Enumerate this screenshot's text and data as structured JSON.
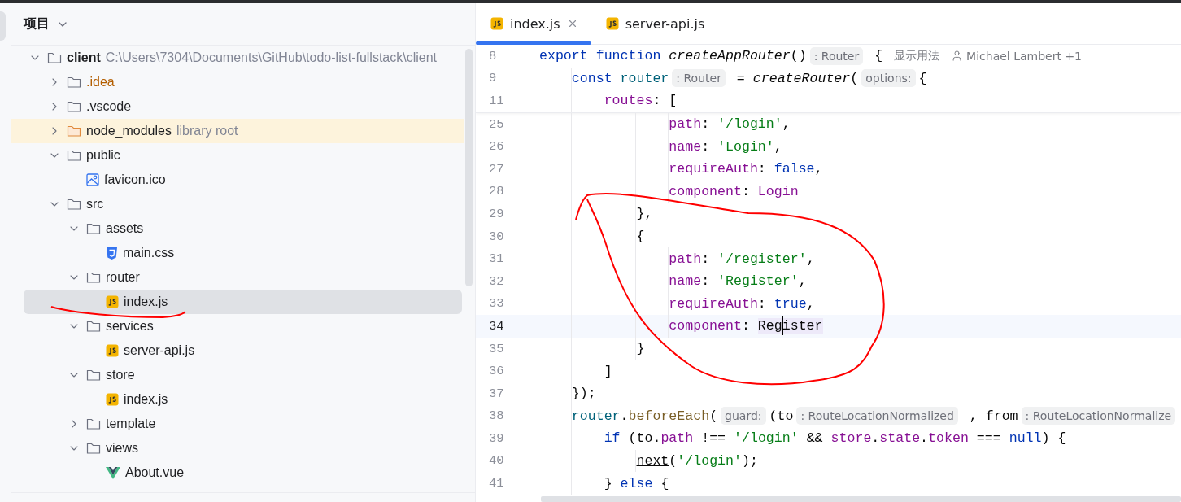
{
  "project_panel": {
    "title": "项目",
    "tree": [
      {
        "name": "client",
        "kind": "folder",
        "path": "C:\\Users\\7304\\Documents\\GitHub\\todo-list-fullstack\\client",
        "expanded": true,
        "selected": false,
        "children": [
          {
            "name": ".idea",
            "kind": "folder",
            "excluded": true,
            "expanded": false,
            "selected": false
          },
          {
            "name": ".vscode",
            "kind": "folder",
            "expanded": false,
            "selected": false
          },
          {
            "name": "node_modules",
            "kind": "library",
            "note": "library root",
            "expanded": false,
            "selected": false
          },
          {
            "name": "public",
            "kind": "folder",
            "expanded": true,
            "selected": false,
            "children": [
              {
                "name": "favicon.ico",
                "kind": "image",
                "selected": false
              }
            ]
          },
          {
            "name": "src",
            "kind": "folder",
            "expanded": true,
            "selected": false,
            "children": [
              {
                "name": "assets",
                "kind": "folder",
                "expanded": true,
                "selected": false,
                "children": [
                  {
                    "name": "main.css",
                    "kind": "css",
                    "selected": false
                  }
                ]
              },
              {
                "name": "router",
                "kind": "folder",
                "expanded": true,
                "selected": false,
                "children": [
                  {
                    "name": "index.js",
                    "kind": "js",
                    "selected": true
                  }
                ]
              },
              {
                "name": "services",
                "kind": "folder",
                "expanded": true,
                "selected": false,
                "children": [
                  {
                    "name": "server-api.js",
                    "kind": "js",
                    "selected": false
                  }
                ]
              },
              {
                "name": "store",
                "kind": "folder",
                "expanded": true,
                "selected": false,
                "children": [
                  {
                    "name": "index.js",
                    "kind": "js",
                    "selected": false
                  }
                ]
              },
              {
                "name": "template",
                "kind": "folder",
                "expanded": false,
                "selected": false
              },
              {
                "name": "views",
                "kind": "folder",
                "expanded": true,
                "selected": false,
                "children": [
                  {
                    "name": "About.vue",
                    "kind": "vue",
                    "selected": false
                  }
                ]
              }
            ]
          }
        ]
      }
    ]
  },
  "editor": {
    "tabs": [
      {
        "label": "index.js",
        "selected": true,
        "closable": true
      },
      {
        "label": "server-api.js",
        "selected": false,
        "closable": false
      }
    ],
    "sticky_lines": [
      {
        "number": "8",
        "current": false,
        "tokens": [
          {
            "kind": "kw",
            "text": "export function "
          },
          {
            "kind": "fn",
            "text": "createAppRouter"
          },
          {
            "kind": "plain",
            "text": "()"
          },
          {
            "kind": "hint",
            "text": ": Router"
          },
          {
            "kind": "plain",
            "text": " {"
          },
          {
            "kind": "usages",
            "text": "显示用法"
          },
          {
            "kind": "author",
            "text": "Michael Lambert +1"
          }
        ]
      },
      {
        "number": "9",
        "current": false,
        "tokens": [
          {
            "kind": "kw",
            "text": "    const "
          },
          {
            "kind": "var",
            "text": "router"
          },
          {
            "kind": "hint",
            "text": ": Router"
          },
          {
            "kind": "plain",
            "text": " = "
          },
          {
            "kind": "fn",
            "text": "createRouter"
          },
          {
            "kind": "plain",
            "text": "("
          },
          {
            "kind": "hint",
            "text": "options:"
          },
          {
            "kind": "plain",
            "text": "{"
          }
        ]
      },
      {
        "number": "11",
        "current": false,
        "tokens": [
          {
            "kind": "prop",
            "text": "        routes"
          },
          {
            "kind": "plain",
            "text": ": ["
          }
        ]
      }
    ],
    "lines": [
      {
        "number": "25",
        "current": false,
        "tokens": [
          {
            "kind": "prop",
            "text": "                path"
          },
          {
            "kind": "plain",
            "text": ": "
          },
          {
            "kind": "str",
            "text": "'/login'"
          },
          {
            "kind": "plain",
            "text": ","
          }
        ]
      },
      {
        "number": "26",
        "current": false,
        "tokens": [
          {
            "kind": "prop",
            "text": "                name"
          },
          {
            "kind": "plain",
            "text": ": "
          },
          {
            "kind": "str",
            "text": "'Login'"
          },
          {
            "kind": "plain",
            "text": ","
          }
        ]
      },
      {
        "number": "27",
        "current": false,
        "tokens": [
          {
            "kind": "prop",
            "text": "                requireAuth"
          },
          {
            "kind": "plain",
            "text": ": "
          },
          {
            "kind": "kw",
            "text": "false"
          },
          {
            "kind": "plain",
            "text": ","
          }
        ]
      },
      {
        "number": "28",
        "current": false,
        "tokens": [
          {
            "kind": "prop",
            "text": "                component"
          },
          {
            "kind": "plain",
            "text": ": "
          },
          {
            "kind": "prop",
            "text": "Login"
          }
        ]
      },
      {
        "number": "29",
        "current": false,
        "tokens": [
          {
            "kind": "plain",
            "text": "            },"
          }
        ]
      },
      {
        "number": "30",
        "current": false,
        "tokens": [
          {
            "kind": "plain",
            "text": "            {"
          }
        ]
      },
      {
        "number": "31",
        "current": false,
        "tokens": [
          {
            "kind": "prop",
            "text": "                path"
          },
          {
            "kind": "plain",
            "text": ": "
          },
          {
            "kind": "str",
            "text": "'/register'"
          },
          {
            "kind": "plain",
            "text": ","
          }
        ]
      },
      {
        "number": "32",
        "current": false,
        "tokens": [
          {
            "kind": "prop",
            "text": "                name"
          },
          {
            "kind": "plain",
            "text": ": "
          },
          {
            "kind": "str",
            "text": "'Register'"
          },
          {
            "kind": "plain",
            "text": ","
          }
        ]
      },
      {
        "number": "33",
        "current": false,
        "tokens": [
          {
            "kind": "prop",
            "text": "                requireAuth"
          },
          {
            "kind": "plain",
            "text": ": "
          },
          {
            "kind": "kw",
            "text": "true"
          },
          {
            "kind": "plain",
            "text": ","
          }
        ]
      },
      {
        "number": "34",
        "current": true,
        "tokens": [
          {
            "kind": "prop",
            "text": "                component"
          },
          {
            "kind": "plain",
            "text": ": "
          },
          {
            "kind": "usage",
            "text": "Register",
            "caret": true
          }
        ]
      },
      {
        "number": "35",
        "current": false,
        "tokens": [
          {
            "kind": "plain",
            "text": "            }"
          }
        ]
      },
      {
        "number": "36",
        "current": false,
        "tokens": [
          {
            "kind": "plain",
            "text": "        ]"
          }
        ]
      },
      {
        "number": "37",
        "current": false,
        "tokens": [
          {
            "kind": "plain",
            "text": "    });"
          }
        ]
      },
      {
        "number": "38",
        "current": false,
        "tokens": [
          {
            "kind": "var",
            "text": "    router"
          },
          {
            "kind": "plain",
            "text": "."
          },
          {
            "kind": "method",
            "text": "beforeEach"
          },
          {
            "kind": "plain",
            "text": "("
          },
          {
            "kind": "hint",
            "text": "guard:"
          },
          {
            "kind": "plain",
            "text": "("
          },
          {
            "kind": "ul",
            "text": "to"
          },
          {
            "kind": "hint",
            "text": ": RouteLocationNormalized"
          },
          {
            "kind": "plain",
            "text": " , "
          },
          {
            "kind": "ul",
            "text": "from"
          },
          {
            "kind": "hint",
            "text": ": RouteLocationNormalize"
          }
        ]
      },
      {
        "number": "39",
        "current": false,
        "tokens": [
          {
            "kind": "kw",
            "text": "        if "
          },
          {
            "kind": "plain",
            "text": "("
          },
          {
            "kind": "ul",
            "text": "to"
          },
          {
            "kind": "plain",
            "text": "."
          },
          {
            "kind": "prop",
            "text": "path"
          },
          {
            "kind": "plain",
            "text": " !== "
          },
          {
            "kind": "str",
            "text": "'/login'"
          },
          {
            "kind": "plain",
            "text": " && "
          },
          {
            "kind": "prop",
            "text": "store"
          },
          {
            "kind": "plain",
            "text": "."
          },
          {
            "kind": "prop",
            "text": "state"
          },
          {
            "kind": "plain",
            "text": "."
          },
          {
            "kind": "prop",
            "text": "token"
          },
          {
            "kind": "plain",
            "text": " === "
          },
          {
            "kind": "kw",
            "text": "null"
          },
          {
            "kind": "plain",
            "text": ") {"
          }
        ]
      },
      {
        "number": "40",
        "current": false,
        "tokens": [
          {
            "kind": "ul",
            "text": "            next"
          },
          {
            "kind": "plain",
            "text": "("
          },
          {
            "kind": "str",
            "text": "'/login'"
          },
          {
            "kind": "plain",
            "text": ");"
          }
        ]
      },
      {
        "number": "41",
        "current": false,
        "tokens": [
          {
            "kind": "plain",
            "text": "        } "
          },
          {
            "kind": "kw",
            "text": "else"
          },
          {
            "kind": "plain",
            "text": " {"
          }
        ]
      }
    ]
  }
}
